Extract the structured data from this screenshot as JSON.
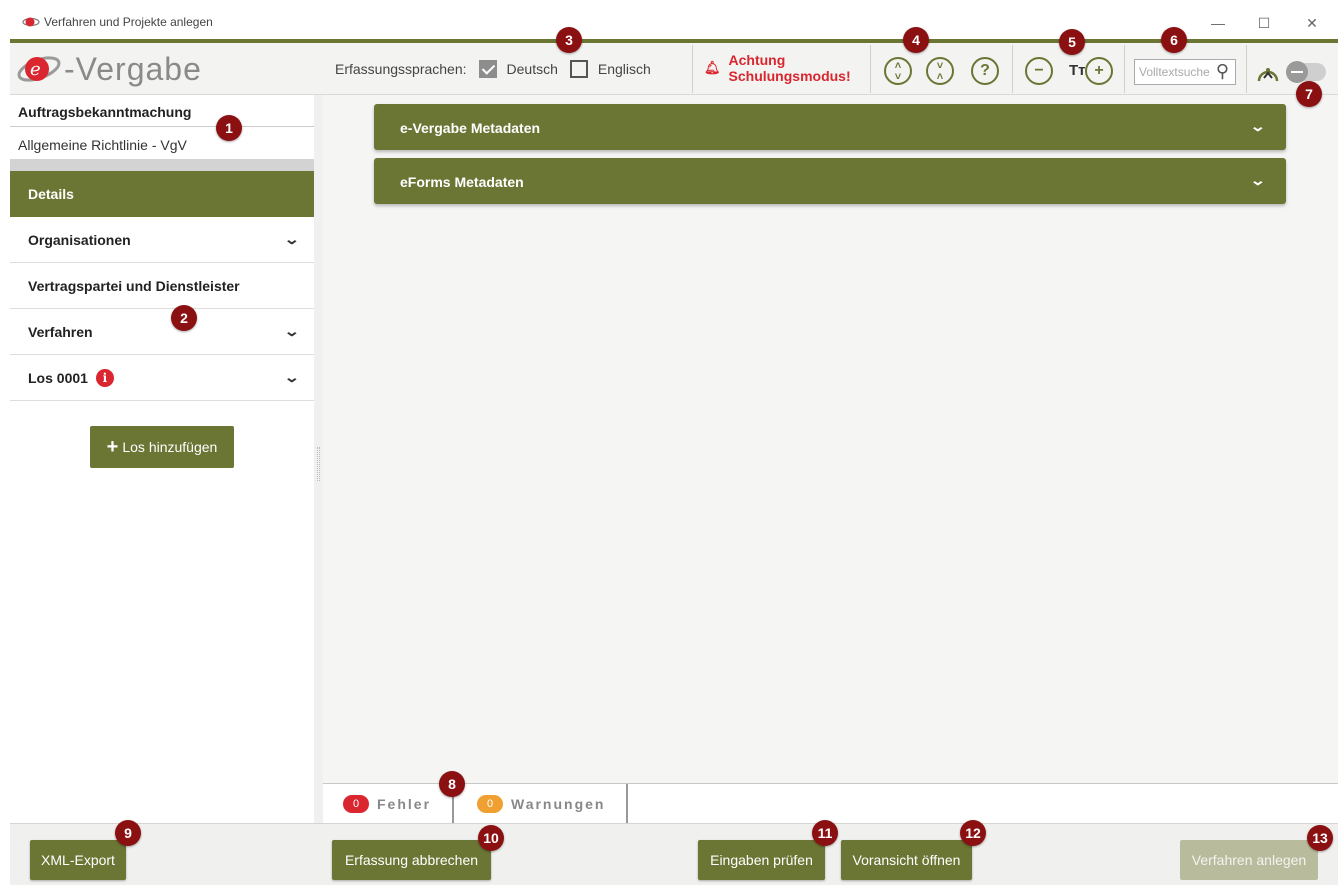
{
  "window": {
    "title": "Verfahren und Projekte anlegen"
  },
  "header": {
    "logo_text": "-Vergabe",
    "languages_label": "Erfassungssprachen:",
    "lang_de": {
      "label": "Deutsch",
      "checked": true
    },
    "lang_en": {
      "label": "Englisch",
      "checked": false
    },
    "warning_line1": "Achtung",
    "warning_line2": "Schulungsmodus!",
    "search_placeholder": "Volltextsuche",
    "colors": {
      "accent": "#6b7534",
      "warning": "#d9262f",
      "marker": "#8b1012"
    }
  },
  "sidebar": {
    "notice_type": "Auftragsbekanntmachung",
    "directive": "Allgemeine Richtlinie - VgV",
    "items": [
      {
        "label": "Details",
        "active": true,
        "expandable": false
      },
      {
        "label": "Organisationen",
        "active": false,
        "expandable": true
      },
      {
        "label": "Vertragspartei und Dienstleister",
        "active": false,
        "expandable": false
      },
      {
        "label": "Verfahren",
        "active": false,
        "expandable": true
      },
      {
        "label": "Los 0001",
        "active": false,
        "expandable": true,
        "info": "i"
      }
    ],
    "add_lot_label": "Los hinzufügen"
  },
  "main": {
    "sections": [
      {
        "title": "e-Vergabe Metadaten"
      },
      {
        "title": "eForms Metadaten"
      }
    ]
  },
  "status_tabs": {
    "errors": {
      "count": "0",
      "label": "Fehler",
      "color": "#d9262f"
    },
    "warnings": {
      "count": "0",
      "label": "Warnungen",
      "color": "#f0a030"
    }
  },
  "footer": {
    "xml_export": "XML-Export",
    "cancel": "Erfassung abbrechen",
    "check": "Eingaben prüfen",
    "preview": "Voransicht öffnen",
    "create": "Verfahren anlegen"
  },
  "markers": [
    "1",
    "2",
    "3",
    "4",
    "5",
    "6",
    "7",
    "8",
    "9",
    "10",
    "11",
    "12",
    "13"
  ]
}
